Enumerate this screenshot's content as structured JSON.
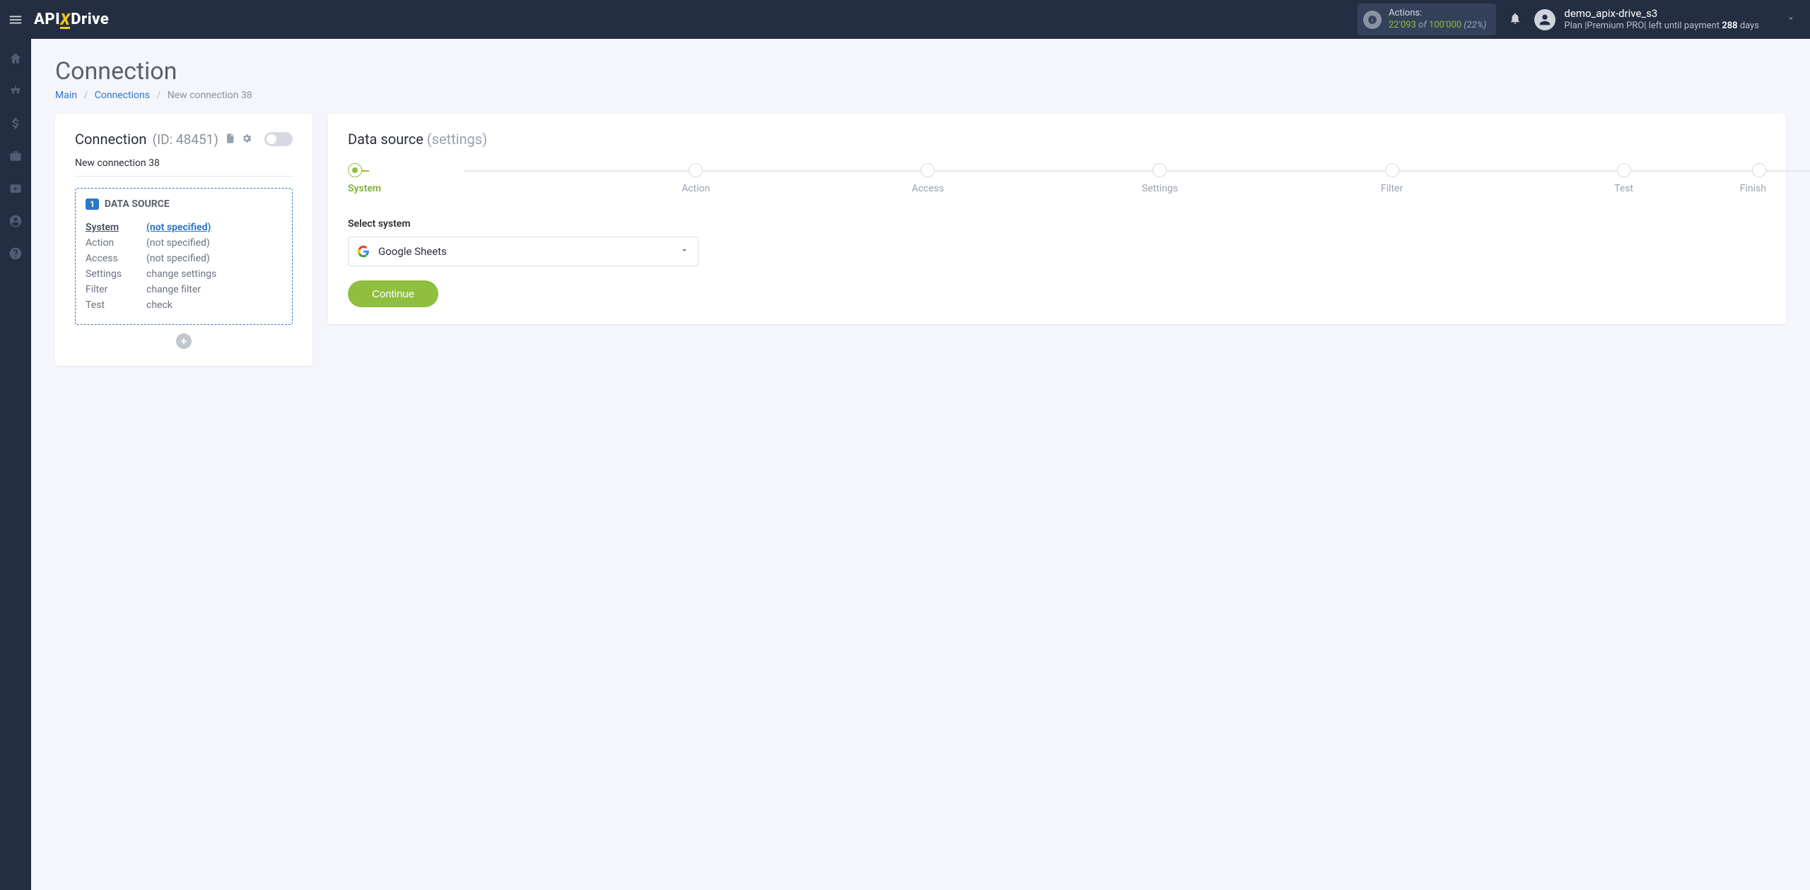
{
  "logo": {
    "part1": "API",
    "x": "X",
    "part2": "Drive"
  },
  "topbar": {
    "actions_label": "Actions:",
    "actions_used": "22'093",
    "actions_of": "of",
    "actions_total": "100'000",
    "actions_pct": "(22%)",
    "user_name": "demo_apix-drive_s3",
    "plan_prefix": "Plan ",
    "plan_name": "|Premium PRO|",
    "plan_mid": " left until payment ",
    "plan_days_num": "288",
    "plan_days_unit": " days"
  },
  "page": {
    "title": "Connection",
    "crumb_main": "Main",
    "crumb_conns": "Connections",
    "crumb_current": "New connection 38"
  },
  "left": {
    "head_label": "Connection",
    "head_id": "(ID: 48451)",
    "conn_name": "New connection 38",
    "ds_badge": "1",
    "ds_title": "DATA SOURCE",
    "rows": [
      {
        "k": "System",
        "v": "(not specified)",
        "active": true
      },
      {
        "k": "Action",
        "v": "(not specified)"
      },
      {
        "k": "Access",
        "v": "(not specified)"
      },
      {
        "k": "Settings",
        "v": "change settings"
      },
      {
        "k": "Filter",
        "v": "change filter"
      },
      {
        "k": "Test",
        "v": "check"
      }
    ]
  },
  "right": {
    "title": "Data source",
    "title_sub": "(settings)",
    "steps": [
      "System",
      "Action",
      "Access",
      "Settings",
      "Filter",
      "Test",
      "Finish"
    ],
    "active_step": 0,
    "select_label": "Select system",
    "select_value": "Google Sheets",
    "continue": "Continue"
  }
}
